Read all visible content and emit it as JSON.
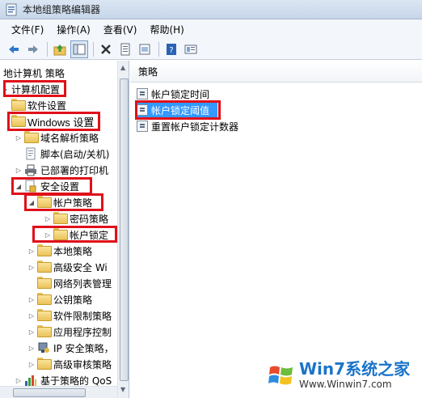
{
  "window": {
    "title": "本地组策略编辑器"
  },
  "menu": [
    {
      "label": "文件(F)"
    },
    {
      "label": "操作(A)"
    },
    {
      "label": "查看(V)"
    },
    {
      "label": "帮助(H)"
    }
  ],
  "toolbar": {
    "buttons": [
      "back-icon",
      "forward-icon",
      "up-folder-icon",
      "show-tree-icon",
      "delete-icon",
      "properties-icon",
      "export-icon",
      "help-icon",
      "filter-icon"
    ]
  },
  "tree": {
    "items": [
      {
        "label": "地计算机 策略",
        "icon": "computer-policy-icon",
        "expander": ""
      },
      {
        "label": "计算机配置",
        "icon": "computer-icon",
        "expander": "◢"
      },
      {
        "label": "软件设置",
        "icon": "folder-icon",
        "expander": ""
      },
      {
        "label": "Windows 设置",
        "icon": "folder-icon",
        "expander": ""
      },
      {
        "label": "域名解析策略",
        "icon": "folder-icon",
        "expander": "▷"
      },
      {
        "label": "脚本(启动/关机)",
        "icon": "script-icon",
        "expander": ""
      },
      {
        "label": "已部署的打印机",
        "icon": "printer-icon",
        "expander": "▷"
      },
      {
        "label": "安全设置",
        "icon": "security-icon",
        "expander": "◢"
      },
      {
        "label": "帐户策略",
        "icon": "locked-folder-icon",
        "expander": "◢"
      },
      {
        "label": "密码策略",
        "icon": "locked-folder-icon",
        "expander": "▷"
      },
      {
        "label": "帐户锁定",
        "icon": "locked-folder-icon",
        "expander": "▷"
      },
      {
        "label": "本地策略",
        "icon": "locked-folder-icon",
        "expander": "▷"
      },
      {
        "label": "高级安全 Wi",
        "icon": "folder-icon",
        "expander": "▷"
      },
      {
        "label": "网络列表管理",
        "icon": "folder-icon",
        "expander": ""
      },
      {
        "label": "公钥策略",
        "icon": "folder-icon",
        "expander": "▷"
      },
      {
        "label": "软件限制策略",
        "icon": "folder-icon",
        "expander": "▷"
      },
      {
        "label": "应用程序控制",
        "icon": "folder-icon",
        "expander": "▷"
      },
      {
        "label": "IP 安全策略，",
        "icon": "ip-security-icon",
        "expander": "▷"
      },
      {
        "label": "高级审核策略",
        "icon": "folder-icon",
        "expander": "▷"
      },
      {
        "label": "基于策略的 QoS",
        "icon": "chart-icon",
        "expander": "▷"
      }
    ]
  },
  "list": {
    "header": "策略",
    "items": [
      {
        "label": "帐户锁定时间",
        "selected": false
      },
      {
        "label": "帐户锁定阈值",
        "selected": true
      },
      {
        "label": "重置帐户锁定计数器",
        "selected": false
      }
    ]
  },
  "watermark": {
    "brand": "Win7系统之家",
    "url": "Www.Winwin7.com"
  },
  "colors": {
    "highlight_box": "#e0101a",
    "selection": "#3399ff"
  }
}
